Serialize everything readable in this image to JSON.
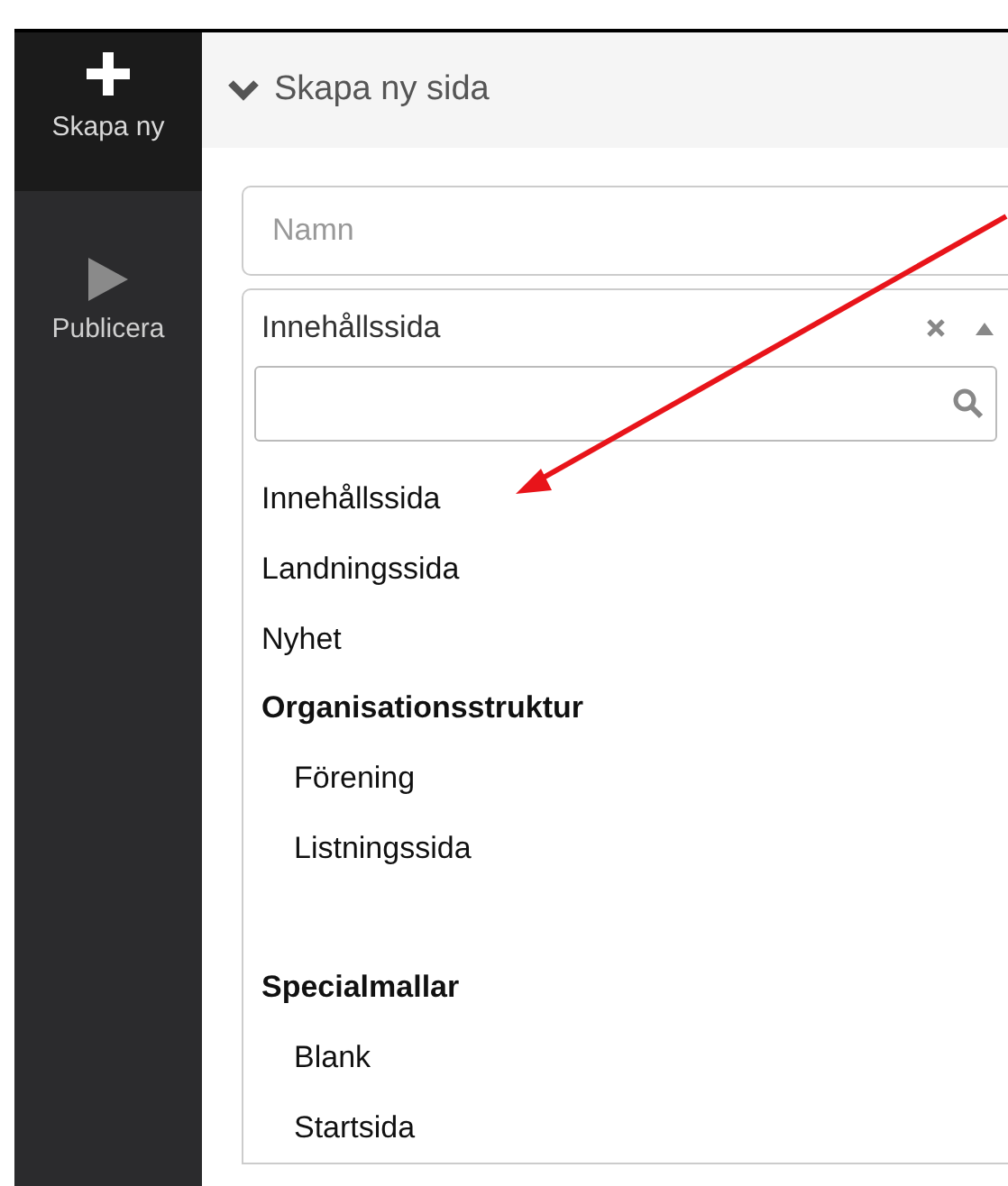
{
  "sidebar": {
    "items": [
      {
        "kind": "create",
        "label": "Skapa ny",
        "selected": true
      },
      {
        "kind": "publish",
        "label": "Publicera",
        "selected": false
      }
    ]
  },
  "panel": {
    "title": "Skapa ny sida",
    "expanded": true,
    "name_field": {
      "placeholder": "Namn"
    },
    "page_type_select": {
      "value": "Innehållssida",
      "open": true,
      "options": [
        {
          "kind": "option",
          "label": "Innehållssida"
        },
        {
          "kind": "option",
          "label": "Landningssida"
        },
        {
          "kind": "option",
          "label": "Nyhet"
        },
        {
          "kind": "group",
          "label": "Organisationsstruktur",
          "children": [
            {
              "kind": "option",
              "label": "Förening"
            },
            {
              "kind": "option",
              "label": "Listningssida"
            }
          ]
        },
        {
          "kind": "group",
          "label": "Specialmallar",
          "children": [
            {
              "kind": "option",
              "label": "Blank"
            },
            {
              "kind": "option",
              "label": "Startsida"
            }
          ]
        }
      ]
    }
  }
}
